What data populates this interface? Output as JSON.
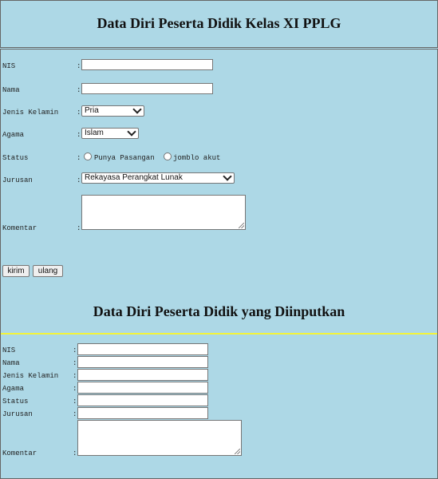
{
  "header": {
    "title": "Data Diri Peserta Didik Kelas XI PPLG"
  },
  "form": {
    "colon": ":",
    "labels": {
      "nis": "NIS",
      "nama": "Nama",
      "jenis_kelamin": "Jenis Kelamin",
      "agama": "Agama",
      "status": "Status",
      "jurusan": "Jurusan",
      "komentar": "Komentar"
    },
    "values": {
      "nis": "",
      "nama": "",
      "jenis_kelamin": "Pria",
      "agama": "Islam",
      "jurusan": "Rekayasa Perangkat Lunak",
      "komentar": ""
    },
    "status_options": [
      "Punya Pasangan",
      "jomblo akut"
    ],
    "buttons": {
      "submit": "kirim",
      "reset": "ulang"
    }
  },
  "output": {
    "title": "Data Diri Peserta Didik yang Diinputkan",
    "colon": ":",
    "labels": {
      "nis": "NIS",
      "nama": "Nama",
      "jenis_kelamin": "Jenis Kelamin",
      "agama": "Agama",
      "status": "Status",
      "jurusan": "Jurusan",
      "komentar": "Komentar"
    },
    "values": {
      "nis": "",
      "nama": "",
      "jenis_kelamin": "",
      "agama": "",
      "status": "",
      "jurusan": "",
      "komentar": ""
    }
  },
  "colors": {
    "background": "#add8e6",
    "divider": "#f3f33a"
  }
}
